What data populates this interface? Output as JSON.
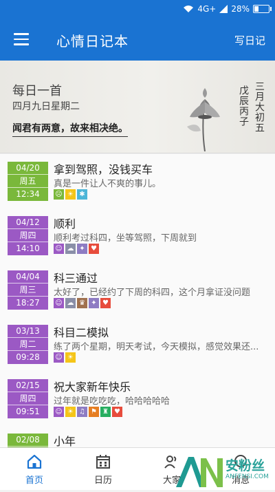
{
  "status": {
    "signal": "4G+",
    "battery": "28%",
    "battery_level": 0.28
  },
  "appbar": {
    "title": "心情日记本",
    "write": "写日记"
  },
  "poem": {
    "heading": "每日一首",
    "date": "四月九日星期二",
    "line": "闻君有两意，故来相决绝。",
    "lunar_col1": "三月大初五",
    "lunar_col2": "戊辰丙子"
  },
  "entries": [
    {
      "md": "04/20",
      "wd": "周五",
      "tm": "12:34",
      "color": "#7ab83b",
      "title": "拿到驾照，没钱买车",
      "body": "真是一件让人不爽的事儿。",
      "tags": [
        {
          "c": "#7ab83b",
          "g": "☹"
        },
        {
          "c": "#f5c518",
          "g": "☀"
        },
        {
          "c": "#4db6d8",
          "g": "✱"
        }
      ]
    },
    {
      "md": "04/12",
      "wd": "周四",
      "tm": "14:10",
      "color": "#9b59c4",
      "title": "顺利",
      "body": "顺利考过科四，坐等驾照，下周就到",
      "tags": [
        {
          "c": "#9b59c4",
          "g": "☺"
        },
        {
          "c": "#8a8fa8",
          "g": "☁"
        },
        {
          "c": "#8e7cc3",
          "g": "✦"
        },
        {
          "c": "#e74c3c",
          "g": "♥"
        }
      ]
    },
    {
      "md": "04/04",
      "wd": "周三",
      "tm": "18:27",
      "color": "#9b59c4",
      "title": "科三通过",
      "body": "太好了，已经约了下周的科四，这个月拿证没问题",
      "tags": [
        {
          "c": "#9b59c4",
          "g": "☺"
        },
        {
          "c": "#8a8fa8",
          "g": "☁"
        },
        {
          "c": "#a0714f",
          "g": "♛"
        },
        {
          "c": "#8e7cc3",
          "g": "✦"
        },
        {
          "c": "#e74c3c",
          "g": "♥"
        }
      ]
    },
    {
      "md": "03/13",
      "wd": "周二",
      "tm": "09:28",
      "color": "#9b59c4",
      "title": "科目二模拟",
      "body": "练了两个星期，明天考试，今天模拟，感觉效果还...",
      "tags": [
        {
          "c": "#9b59c4",
          "g": "☺"
        },
        {
          "c": "#f5c518",
          "g": "☀"
        }
      ]
    },
    {
      "md": "02/15",
      "wd": "周四",
      "tm": "09:51",
      "color": "#9b59c4",
      "title": "祝大家新年快乐",
      "body": "过年就是吃吃吃，哈哈哈哈哈",
      "tags": [
        {
          "c": "#9b59c4",
          "g": "☺"
        },
        {
          "c": "#f5c518",
          "g": "☀"
        },
        {
          "c": "#8e7cc3",
          "g": "♫"
        },
        {
          "c": "#e67e22",
          "g": "⚑"
        },
        {
          "c": "#27ae60",
          "g": "♜"
        },
        {
          "c": "#e74c3c",
          "g": "♥"
        }
      ]
    },
    {
      "md": "02/08",
      "wd": "",
      "tm": "",
      "color": "#7ab83b",
      "title": "小年",
      "body": "",
      "tags": []
    }
  ],
  "tabs": [
    {
      "label": "首页",
      "icon": "home-icon"
    },
    {
      "label": "日历",
      "icon": "calendar-icon"
    },
    {
      "label": "大家",
      "icon": "people-icon"
    },
    {
      "label": "消息",
      "icon": "message-icon"
    }
  ],
  "watermark": {
    "big": "安粉丝",
    "small": "ANFENSI.COM"
  }
}
